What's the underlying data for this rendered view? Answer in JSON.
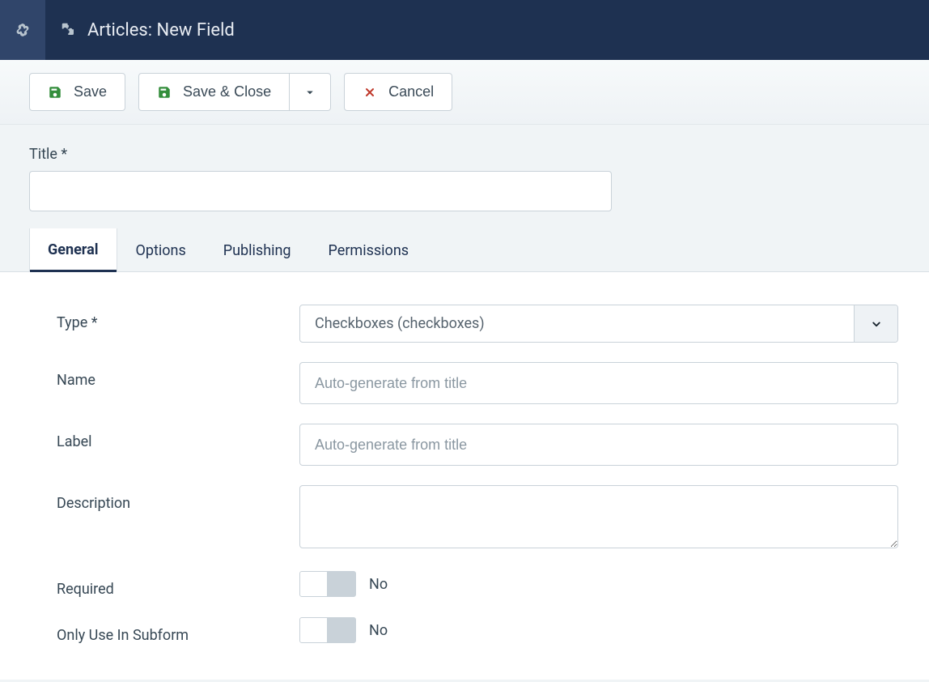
{
  "header": {
    "title": "Articles: New Field"
  },
  "toolbar": {
    "save": "Save",
    "saveClose": "Save & Close",
    "cancel": "Cancel"
  },
  "titleField": {
    "label": "Title *",
    "value": ""
  },
  "tabs": [
    {
      "label": "General",
      "active": true
    },
    {
      "label": "Options",
      "active": false
    },
    {
      "label": "Publishing",
      "active": false
    },
    {
      "label": "Permissions",
      "active": false
    }
  ],
  "form": {
    "type": {
      "label": "Type *",
      "value": "Checkboxes (checkboxes)"
    },
    "name": {
      "label": "Name",
      "placeholder": "Auto-generate from title",
      "value": ""
    },
    "labelField": {
      "label": "Label",
      "placeholder": "Auto-generate from title",
      "value": ""
    },
    "description": {
      "label": "Description",
      "value": ""
    },
    "required": {
      "label": "Required",
      "value": "No"
    },
    "onlySubform": {
      "label": "Only Use In Subform",
      "value": "No"
    }
  }
}
